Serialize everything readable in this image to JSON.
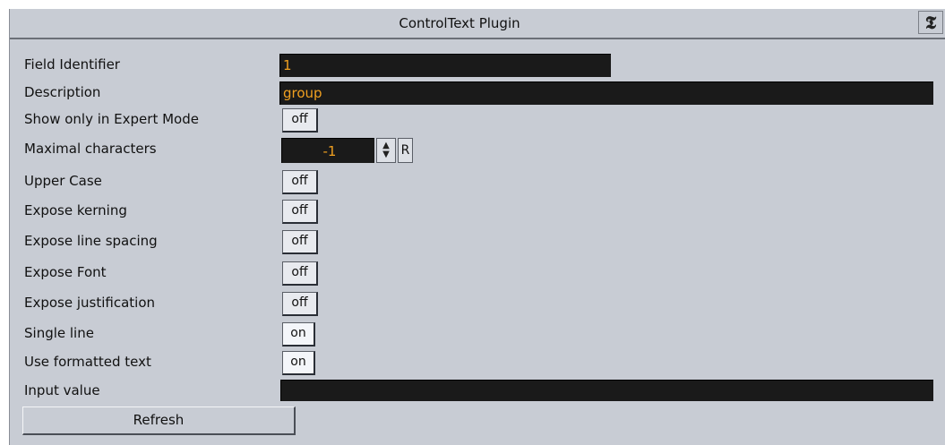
{
  "window": {
    "title": "ControlText Plugin",
    "icon": "plugin-logo-icon"
  },
  "fields": {
    "field_identifier": {
      "label": "Field Identifier",
      "value": "1"
    },
    "description": {
      "label": "Description",
      "value": "group"
    },
    "expert_mode": {
      "label": "Show only in Expert Mode",
      "value": "off"
    },
    "max_chars": {
      "label": "Maximal characters",
      "value": "-1",
      "reset": "R"
    },
    "upper_case": {
      "label": "Upper Case",
      "value": "off"
    },
    "kerning": {
      "label": "Expose kerning",
      "value": "off"
    },
    "line_spacing": {
      "label": "Expose line spacing",
      "value": "off"
    },
    "font": {
      "label": "Expose Font",
      "value": "off"
    },
    "justification": {
      "label": "Expose justification",
      "value": "off"
    },
    "single_line": {
      "label": "Single line",
      "value": "on"
    },
    "formatted_text": {
      "label": "Use formatted text",
      "value": "on"
    },
    "input_value": {
      "label": "Input value",
      "value": ""
    }
  },
  "refresh_label": "Refresh",
  "colors": {
    "panel": "#c8ccd4",
    "field_bg": "#1a1a1a",
    "field_text": "#f0a020"
  }
}
